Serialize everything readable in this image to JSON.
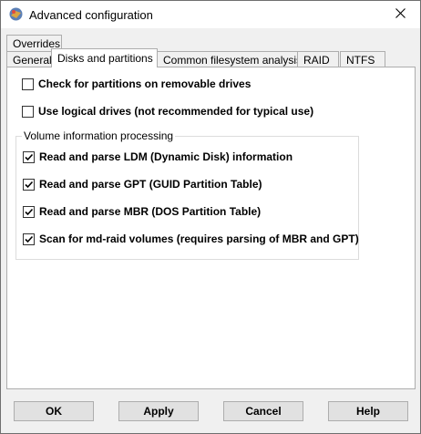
{
  "window": {
    "title": "Advanced configuration",
    "icon": "app-icon",
    "close_icon": "close-icon"
  },
  "tabs": {
    "row1": [
      {
        "label": "Overrides"
      }
    ],
    "row2": [
      {
        "label": "General"
      },
      {
        "label": "Disks and partitions",
        "active": true
      },
      {
        "label": "Common filesystem analysis"
      },
      {
        "label": "RAID"
      },
      {
        "label": "NTFS"
      }
    ]
  },
  "options": [
    {
      "label": "Check for partitions on removable drives",
      "checked": false
    },
    {
      "label": "Use logical drives (not recommended for typical use)",
      "checked": false
    }
  ],
  "volume_group": {
    "title": "Volume information processing",
    "options": [
      {
        "label": "Read and parse LDM (Dynamic Disk) information",
        "checked": true
      },
      {
        "label": "Read and parse GPT (GUID Partition Table)",
        "checked": true
      },
      {
        "label": "Read and parse MBR (DOS Partition Table)",
        "checked": true
      },
      {
        "label": "Scan for md-raid volumes (requires parsing of MBR and GPT)",
        "checked": true
      }
    ]
  },
  "buttons": {
    "ok": "OK",
    "apply": "Apply",
    "cancel": "Cancel",
    "help": "Help"
  }
}
